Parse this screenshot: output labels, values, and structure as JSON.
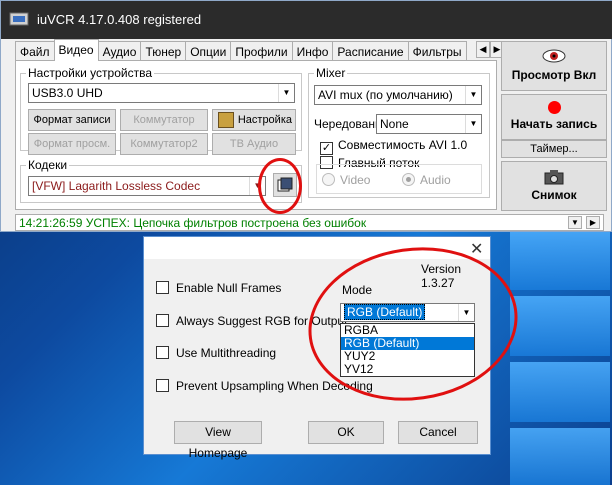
{
  "window": {
    "title": "iuVCR 4.17.0.408 registered"
  },
  "tabs": [
    "Файл",
    "Видео",
    "Аудио",
    "Тюнер",
    "Опции",
    "Профили",
    "Инфо",
    "Расписание",
    "Фильтры"
  ],
  "active_tab": "Видео",
  "device_settings": {
    "group_label": "Настройки устройства",
    "device_value": "USB3.0 UHD",
    "buttons": {
      "capture_format": "Формат записи",
      "switcher": "Коммутатор",
      "settings": "Настройка",
      "preview_format": "Формат просм.",
      "switcher2": "Коммутатор2",
      "tv_audio": "ТВ Аудио"
    }
  },
  "codecs": {
    "group_label": "Кодеки",
    "codec_value": "[VFW] Lagarith Lossless Codec"
  },
  "mixer": {
    "group_label": "Mixer",
    "mixer_value": "AVI mux (по умолчанию)",
    "interleave_label": "Чередование",
    "interleave_value": "None",
    "avi_compat_label": "Совместимость AVI 1.0",
    "avi_compat_checked": true,
    "main_stream_label": "Главный поток",
    "main_stream_checked": false,
    "video_label": "Video",
    "audio_label": "Audio"
  },
  "right_buttons": {
    "preview": "Просмотр Вкл",
    "record": "Начать запись",
    "timer": "Таймер...",
    "snapshot": "Снимок"
  },
  "status": {
    "text": "14:21:26:59 УСПЕХ: Цепочка фильтров построена без ошибок"
  },
  "dialog": {
    "close_glyph": "✕",
    "version": "Version 1.3.27",
    "options": [
      "Enable Null Frames",
      "Always Suggest RGB for Output",
      "Use Multithreading",
      "Prevent Upsampling When Decoding"
    ],
    "mode_label": "Mode",
    "mode_value": "RGB (Default)",
    "mode_options": [
      "RGBA",
      "RGB (Default)",
      "YUY2",
      "YV12"
    ],
    "selected_option": "RGB (Default)",
    "buttons": {
      "homepage": "View Homepage",
      "ok": "OK",
      "cancel": "Cancel"
    }
  },
  "colors": {
    "status_text": "#008000",
    "selection": "#0078d7",
    "annotation": "#e01010"
  }
}
